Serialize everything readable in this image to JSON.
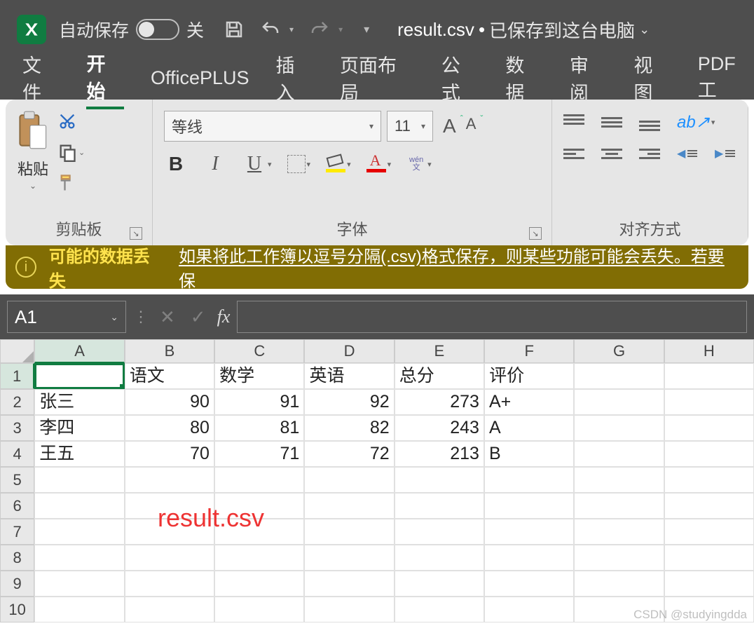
{
  "titlebar": {
    "autosave_label": "自动保存",
    "autosave_state": "关",
    "filename": "result.csv",
    "saved_status": "已保存到这台电脑"
  },
  "tabs": [
    "文件",
    "开始",
    "OfficePLUS",
    "插入",
    "页面布局",
    "公式",
    "数据",
    "审阅",
    "视图",
    "PDF工"
  ],
  "active_tab_index": 1,
  "ribbon": {
    "clipboard": {
      "label": "剪贴板",
      "paste": "粘贴"
    },
    "font": {
      "label": "字体",
      "name": "等线",
      "size": "11",
      "wen_top": "wén",
      "wen_bot": "文"
    },
    "alignment": {
      "label": "对齐方式"
    }
  },
  "warning": {
    "title": "可能的数据丢失",
    "msg": "如果将此工作簿以逗号分隔(.csv)格式保存，则某些功能可能会丢失。若要保"
  },
  "formula_bar": {
    "cell_ref": "A1",
    "fx": "fx"
  },
  "sheet": {
    "columns": [
      "A",
      "B",
      "C",
      "D",
      "E",
      "F",
      "G",
      "H"
    ],
    "active_col_index": 0,
    "active_row_index": 0,
    "rows": [
      {
        "n": "1",
        "cells": [
          "",
          "语文",
          "数学",
          "英语",
          "总分",
          "评价",
          "",
          ""
        ]
      },
      {
        "n": "2",
        "cells": [
          "张三",
          "90",
          "91",
          "92",
          "273",
          "A+",
          "",
          ""
        ]
      },
      {
        "n": "3",
        "cells": [
          "李四",
          "80",
          "81",
          "82",
          "243",
          "A",
          "",
          ""
        ]
      },
      {
        "n": "4",
        "cells": [
          "王五",
          "70",
          "71",
          "72",
          "213",
          "B",
          "",
          ""
        ]
      },
      {
        "n": "5",
        "cells": [
          "",
          "",
          "",
          "",
          "",
          "",
          "",
          ""
        ]
      },
      {
        "n": "6",
        "cells": [
          "",
          "",
          "",
          "",
          "",
          "",
          "",
          ""
        ]
      },
      {
        "n": "7",
        "cells": [
          "",
          "",
          "",
          "",
          "",
          "",
          "",
          ""
        ]
      },
      {
        "n": "8",
        "cells": [
          "",
          "",
          "",
          "",
          "",
          "",
          "",
          ""
        ]
      },
      {
        "n": "9",
        "cells": [
          "",
          "",
          "",
          "",
          "",
          "",
          "",
          ""
        ]
      },
      {
        "n": "10",
        "cells": [
          "",
          "",
          "",
          "",
          "",
          "",
          "",
          ""
        ]
      }
    ],
    "numeric_cols": [
      1,
      2,
      3,
      4
    ],
    "overlay_text": "result.csv"
  },
  "watermark": "CSDN @studyingdda"
}
